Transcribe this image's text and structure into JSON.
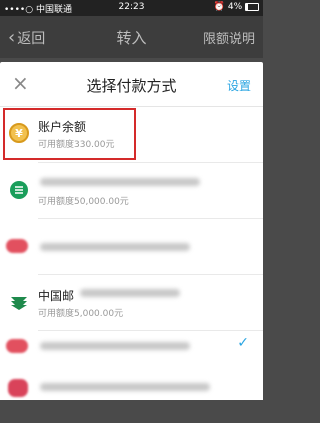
{
  "status_bar": {
    "carrier": "••••○ 中国联通",
    "time": "22:23",
    "battery": "4%"
  },
  "nav": {
    "back_label": "返回",
    "title": "转入",
    "right_label": "限额说明"
  },
  "sheet": {
    "title": "选择付款方式",
    "settings_label": "设置",
    "close_icon": "close-icon"
  },
  "methods": [
    {
      "name": "账户余额",
      "sub": "可用额度330.00元",
      "icon": "coin-icon",
      "selected_frame": true
    },
    {
      "name": "",
      "sub": "可用额度50,000.00元",
      "icon": "bank-icon"
    },
    {
      "name": "",
      "sub": "",
      "icon": "bank-icon"
    },
    {
      "name": "中国邮",
      "sub": "可用额度5,000.00元",
      "icon": "postal-bank-icon"
    },
    {
      "name": "",
      "sub": "",
      "icon": "bank-icon",
      "checked": true
    },
    {
      "name": "",
      "sub": "",
      "icon": "bank-icon"
    }
  ],
  "colors": {
    "accent": "#2aa5e2",
    "highlight": "#d42a2a",
    "nav_bg": "#3d3d3d"
  }
}
